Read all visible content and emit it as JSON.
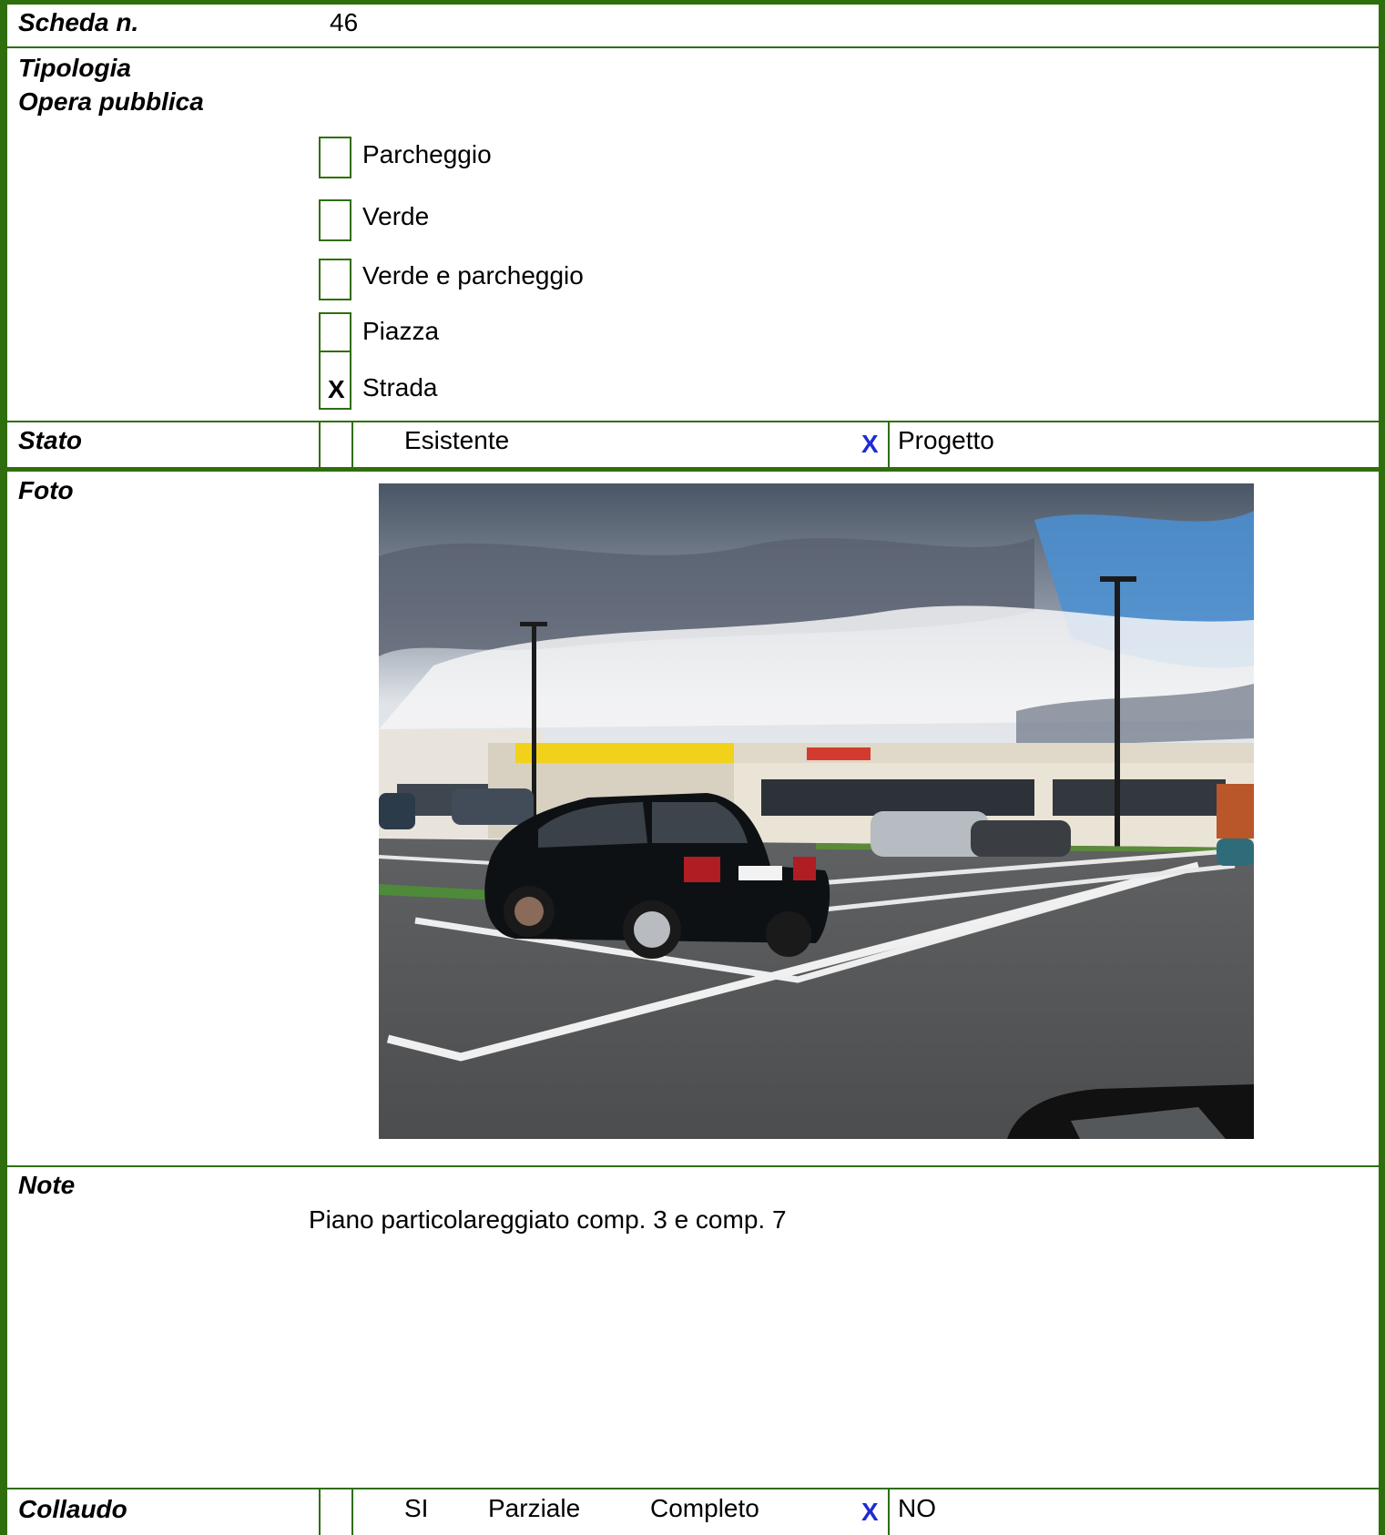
{
  "scheda": {
    "label": "Scheda n.",
    "value": "46"
  },
  "tipologia": {
    "label_line1": "Tipologia",
    "label_line2": "Opera pubblica",
    "options": [
      {
        "label": "Parcheggio",
        "mark": ""
      },
      {
        "label": "Verde",
        "mark": ""
      },
      {
        "label": "Verde e parcheggio",
        "mark": ""
      },
      {
        "label": "Piazza",
        "mark": ""
      },
      {
        "label": "Strada",
        "mark": "X"
      }
    ]
  },
  "stato": {
    "label": "Stato",
    "esistente_label": "Esistente",
    "esistente_mark": "",
    "progetto_label": "Progetto",
    "progetto_mark": "X"
  },
  "foto": {
    "label": "Foto"
  },
  "note": {
    "label": "Note",
    "text": "Piano particolareggiato comp. 3 e comp. 7"
  },
  "collaudo": {
    "label": "Collaudo",
    "si_label": "SI",
    "parziale_label": "Parziale",
    "completo_label": "Completo",
    "no_label": "NO",
    "si_mark": "",
    "no_mark": "X"
  },
  "colors": {
    "border": "#2f6e0c",
    "blue_mark": "#1d2bd6"
  }
}
